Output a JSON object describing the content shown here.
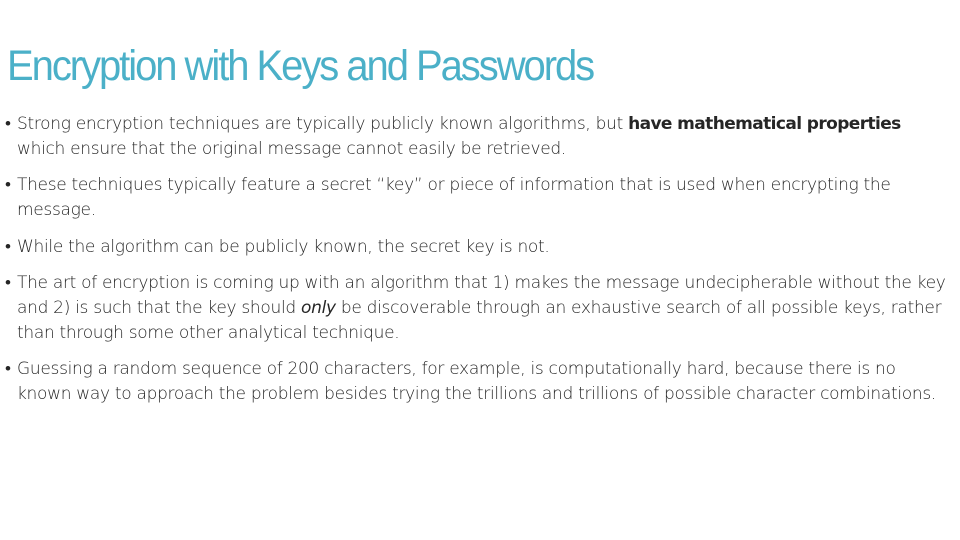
{
  "slide": {
    "title": "Encryption with Keys and Passwords",
    "accent_color": "#4bb0c8",
    "bullet_glyph": "•",
    "bullets": [
      {
        "segments": [
          {
            "text": "Strong encryption techniques are typically publicly known algorithms, but ",
            "style": "normal"
          },
          {
            "text": "have mathematical properties",
            "style": "bold"
          },
          {
            "text": " which ensure that the original message cannot easily be retrieved.",
            "style": "normal"
          }
        ]
      },
      {
        "segments": [
          {
            "text": "These techniques typically feature a secret “key” or piece of information that is used when encrypting the message.",
            "style": "normal"
          }
        ]
      },
      {
        "segments": [
          {
            "text": "While the algorithm can be publicly known, the secret key is not.",
            "style": "normal"
          }
        ]
      },
      {
        "segments": [
          {
            "text": "The art of encryption is coming up with an algorithm that 1) makes the message undecipherable without the key and 2) is such that the key should ",
            "style": "normal"
          },
          {
            "text": "only",
            "style": "italic"
          },
          {
            "text": " be discoverable through an exhaustive search of all possible keys, rather than through some other analytical technique.",
            "style": "normal"
          }
        ]
      },
      {
        "segments": [
          {
            "text": "Guessing a random sequence of 200 characters, for example, is computationally hard, because there is no known way to approach the problem besides trying the trillions and trillions of possible character combinations.",
            "style": "normal"
          }
        ]
      }
    ]
  }
}
